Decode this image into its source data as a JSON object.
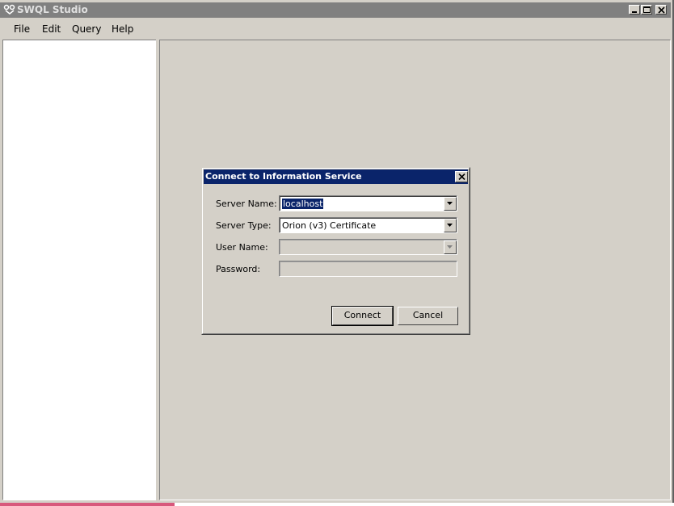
{
  "window": {
    "title": "SWQL Studio"
  },
  "menu": {
    "items": [
      "File",
      "Edit",
      "Query",
      "Help"
    ]
  },
  "dialog": {
    "title": "Connect to Information Service",
    "server_name_label": "Server Name:",
    "server_name_value": "localhost",
    "server_type_label": "Server Type:",
    "server_type_value": "Orion (v3) Certificate",
    "user_name_label": "User Name:",
    "user_name_value": "",
    "password_label": "Password:",
    "password_value": "",
    "connect_label": "Connect",
    "cancel_label": "Cancel"
  },
  "colors": {
    "dialog_title_bg": "#0a246a",
    "window_title_bg": "#808080",
    "face": "#d4d0c8"
  },
  "icons": [
    "app-icon",
    "minimize-icon",
    "maximize-icon",
    "close-icon",
    "dropdown-arrow-icon"
  ]
}
